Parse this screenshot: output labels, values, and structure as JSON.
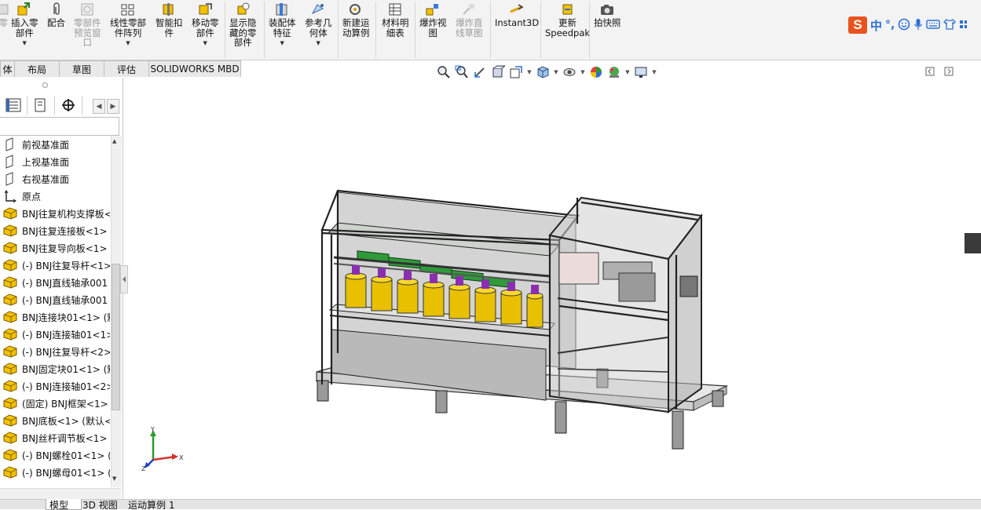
{
  "ribbon": {
    "items": [
      {
        "label": "零",
        "icon": "partial-icon",
        "disabled": true,
        "dropdown": false
      },
      {
        "label": "插入零\n部件",
        "icon": "insert-component-icon",
        "disabled": false,
        "dropdown": true
      },
      {
        "label": "配合",
        "icon": "mate-paperclip-icon",
        "disabled": false,
        "dropdown": false
      },
      {
        "label": "零部件\n预览窗\n口",
        "icon": "component-preview-icon",
        "disabled": true,
        "dropdown": false
      },
      {
        "label": "线性零部\n件阵列",
        "icon": "linear-pattern-icon",
        "disabled": false,
        "dropdown": true
      },
      {
        "label": "智能扣\n件",
        "icon": "smart-fasteners-icon",
        "disabled": false,
        "dropdown": false
      },
      {
        "label": "移动零\n部件",
        "icon": "move-component-icon",
        "disabled": false,
        "dropdown": true
      },
      {
        "label": "显示隐\n藏的零\n部件",
        "icon": "show-hidden-icon",
        "disabled": false,
        "dropdown": false
      },
      {
        "label": "装配体\n特征",
        "icon": "assembly-features-icon",
        "disabled": false,
        "dropdown": true
      },
      {
        "label": "参考几\n何体",
        "icon": "reference-geometry-icon",
        "disabled": false,
        "dropdown": true
      },
      {
        "label": "新建运\n动算例",
        "icon": "new-motion-study-icon",
        "disabled": false,
        "dropdown": false
      },
      {
        "label": "材料明\n细表",
        "icon": "bill-of-materials-icon",
        "disabled": false,
        "dropdown": false
      },
      {
        "label": "爆炸视\n图",
        "icon": "exploded-view-icon",
        "disabled": false,
        "dropdown": false
      },
      {
        "label": "爆炸直\n线草图",
        "icon": "explode-line-sketch-icon",
        "disabled": true,
        "dropdown": false
      },
      {
        "label": "Instant3D",
        "icon": "instant3d-icon",
        "disabled": false,
        "dropdown": false
      },
      {
        "label": "更新\nSpeedpak",
        "icon": "update-speedpak-icon",
        "disabled": false,
        "dropdown": false
      },
      {
        "label": "拍快照",
        "icon": "take-snapshot-icon",
        "disabled": false,
        "dropdown": false
      }
    ]
  },
  "ime": {
    "logo": "S",
    "mode": "中",
    "punct": "°,"
  },
  "tabs": [
    "体",
    "布局",
    "草图",
    "评估",
    "SOLIDWORKS MBD"
  ],
  "tree": [
    {
      "label": "前视基准面",
      "icon": "plane-icon"
    },
    {
      "label": "上视基准面",
      "icon": "plane-icon"
    },
    {
      "label": "右视基准面",
      "icon": "plane-icon"
    },
    {
      "label": "原点",
      "icon": "origin-icon"
    },
    {
      "label": "BNJ往复机构支撑板<",
      "icon": "part-icon"
    },
    {
      "label": "BNJ往复连接板<1>",
      "icon": "part-icon"
    },
    {
      "label": "BNJ往复导向板<1>",
      "icon": "part-icon"
    },
    {
      "label": "(-) BNJ往复导杆<1>",
      "icon": "part-icon"
    },
    {
      "label": "(-) BNJ直线轴承001",
      "icon": "part-icon"
    },
    {
      "label": "(-) BNJ直线轴承001",
      "icon": "part-icon"
    },
    {
      "label": "BNJ连接块01<1> (默",
      "icon": "part-icon"
    },
    {
      "label": "(-) BNJ连接轴01<1>",
      "icon": "part-icon"
    },
    {
      "label": "(-) BNJ往复导杆<2>",
      "icon": "part-icon"
    },
    {
      "label": "BNJ固定块01<1> (默",
      "icon": "part-icon"
    },
    {
      "label": "(-) BNJ连接轴01<2>",
      "icon": "part-icon"
    },
    {
      "label": "(固定) BNJ框架<1>",
      "icon": "part-icon"
    },
    {
      "label": "BNJ底板<1> (默认<",
      "icon": "part-icon"
    },
    {
      "label": "BNJ丝杆调节板<1>",
      "icon": "part-icon"
    },
    {
      "label": "(-) BNJ螺栓01<1> (",
      "icon": "part-icon"
    },
    {
      "label": "(-) BNJ螺母01<1> (",
      "icon": "part-icon"
    }
  ],
  "bottom_tabs": [
    "模型",
    "3D 视图",
    "运动算例 1"
  ],
  "triad": {
    "x": "X",
    "y": "Y",
    "z": "Z"
  },
  "colors": {
    "part_yellow": "#f2c200",
    "axis_x": "#d83030",
    "axis_y": "#2b9a2b",
    "axis_z": "#2040c8",
    "ime_orange": "#e8531e"
  }
}
